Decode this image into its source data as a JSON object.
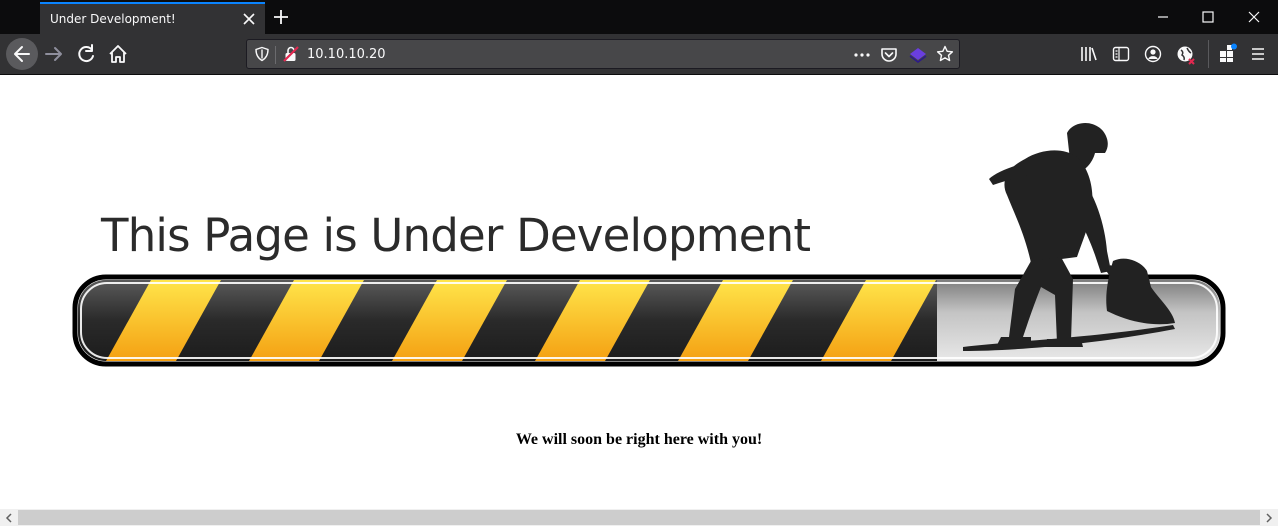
{
  "browser": {
    "tab_title": "Under Development!",
    "url": "10.10.10.20"
  },
  "page": {
    "banner_heading": "This Page is Under Development",
    "message": "We will soon be right here with you!"
  },
  "colors": {
    "stripe_yellow": "#fbbf1a",
    "stripe_dark": "#2b2b2b",
    "figure": "#202020",
    "tab_accent": "#0a84ff"
  }
}
